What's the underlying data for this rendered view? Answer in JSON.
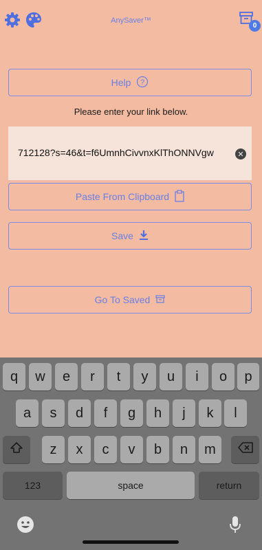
{
  "header": {
    "app_title": "AnySaver™",
    "badge_count": "0",
    "icons": [
      "gear-icon",
      "palette-icon",
      "archive-icon"
    ]
  },
  "buttons": {
    "help": "Help",
    "paste": "Paste From Clipboard",
    "save": "Save",
    "go_to_saved": "Go To Saved"
  },
  "prompt": "Please enter your link below.",
  "link_field": {
    "value": "712128?s=46&t=f6UmnhCivvnxKlThONNVgw"
  },
  "keyboard": {
    "row1": [
      "q",
      "w",
      "e",
      "r",
      "t",
      "y",
      "u",
      "i",
      "o",
      "p"
    ],
    "row2": [
      "a",
      "s",
      "d",
      "f",
      "g",
      "h",
      "j",
      "k",
      "l"
    ],
    "row3": [
      "z",
      "x",
      "c",
      "v",
      "b",
      "n",
      "m"
    ],
    "numbers": "123",
    "space": "space",
    "return": "return"
  },
  "colors": {
    "background": "#f2bba2",
    "accent": "#6a7fe6",
    "keyboard": "#737373"
  }
}
